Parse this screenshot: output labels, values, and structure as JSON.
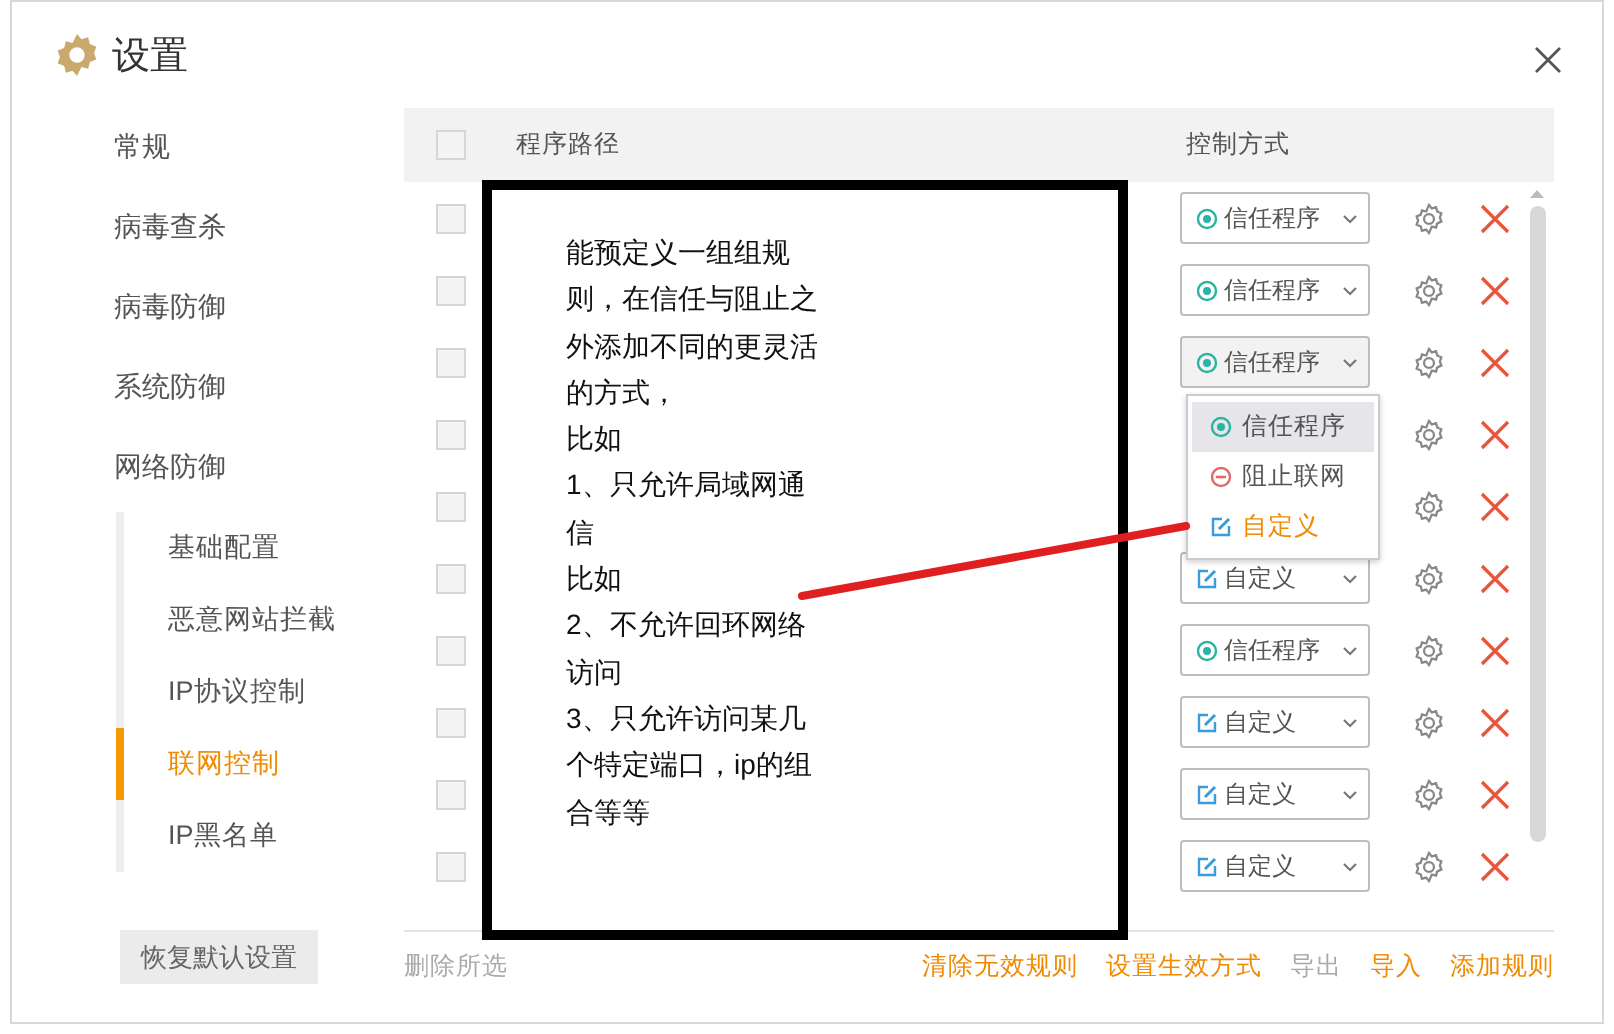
{
  "window": {
    "title": "设置"
  },
  "sidebar": {
    "items": [
      {
        "label": "常规",
        "selected": false
      },
      {
        "label": "病毒查杀",
        "selected": false
      },
      {
        "label": "病毒防御",
        "selected": false
      },
      {
        "label": "系统防御",
        "selected": false
      },
      {
        "label": "网络防御",
        "selected": false,
        "children": [
          {
            "label": "基础配置",
            "selected": false
          },
          {
            "label": "恶意网站拦截",
            "selected": false
          },
          {
            "label": "IP协议控制",
            "selected": false
          },
          {
            "label": "联网控制",
            "selected": true
          },
          {
            "label": "IP黑名单",
            "selected": false
          }
        ]
      }
    ],
    "restore_button": "恢复默认设置"
  },
  "table": {
    "header_checked": false,
    "columns": [
      "程序路径",
      "控制方式"
    ],
    "rows": [
      {
        "checked": false,
        "mode": {
          "kind": "trust",
          "label": "信任程序"
        }
      },
      {
        "checked": false,
        "mode": {
          "kind": "trust",
          "label": "信任程序"
        }
      },
      {
        "checked": false,
        "mode": {
          "kind": "trust",
          "label": "信任程序",
          "open": true
        }
      },
      {
        "checked": false
      },
      {
        "checked": false
      },
      {
        "checked": false,
        "mode": {
          "kind": "custom",
          "label": "自定义"
        }
      },
      {
        "checked": false,
        "mode": {
          "kind": "trust",
          "label": "信任程序"
        }
      },
      {
        "checked": false,
        "mode": {
          "kind": "custom",
          "label": "自定义"
        }
      },
      {
        "checked": false,
        "mode": {
          "kind": "custom",
          "label": "自定义"
        }
      },
      {
        "checked": false,
        "mode": {
          "kind": "custom",
          "label": "自定义"
        }
      }
    ]
  },
  "dropdown": {
    "options": [
      {
        "kind": "trust",
        "label": "信任程序",
        "selected": true,
        "highlighted": false
      },
      {
        "kind": "block",
        "label": "阻止联网",
        "selected": false,
        "highlighted": false
      },
      {
        "kind": "custom",
        "label": "自定义",
        "selected": false,
        "highlighted": true
      }
    ]
  },
  "footer": {
    "left": {
      "label": "删除所选",
      "disabled": true
    },
    "actions": [
      {
        "label": "清除无效规则",
        "disabled": false
      },
      {
        "label": "设置生效方式",
        "disabled": false
      },
      {
        "label": "导出",
        "disabled": true
      },
      {
        "label": "导入",
        "disabled": false
      },
      {
        "label": "添加规则",
        "disabled": false
      }
    ]
  },
  "annotation": {
    "lines": [
      "能预定义一组组规",
      "则，在信任与阻止之",
      "外添加不同的更灵活",
      "的方式，",
      "比如",
      "1、只允许局域网通",
      "信",
      "比如",
      "2、不允许回环网络",
      "访问",
      "3、只允许访问某几",
      "个特定端口，ip的组",
      "合等等"
    ]
  }
}
